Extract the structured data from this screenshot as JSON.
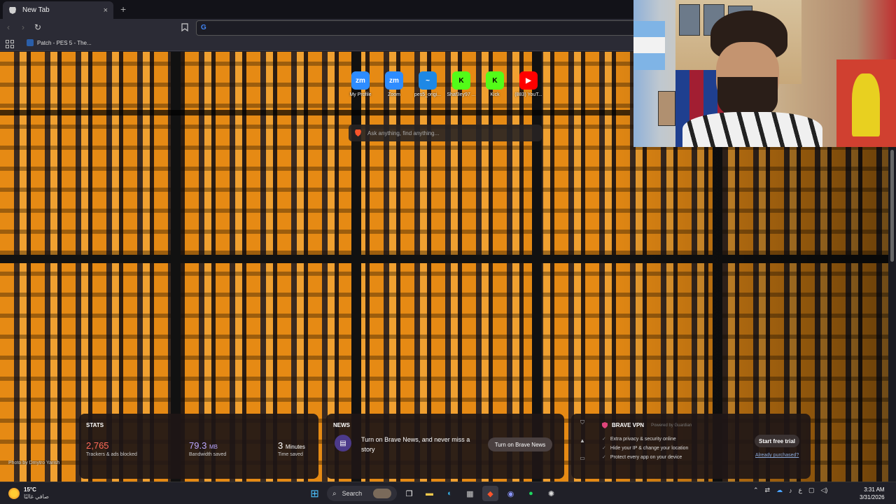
{
  "browser": {
    "tab_title": "New Tab",
    "tab_close": "×",
    "new_tab": "+",
    "back": "‹",
    "forward": "›",
    "reload": "↻",
    "url_value": "",
    "bookmark_label": "Patch - PES 5 - The..."
  },
  "top_sites": [
    {
      "label": "My Profile",
      "icon": "zm",
      "color": "#2d8cff"
    },
    {
      "label": "Zoom",
      "icon": "zm",
      "color": "#2d8cff"
    },
    {
      "label": "pes5_origi...",
      "icon": "~",
      "color": "#1e88e5"
    },
    {
      "label": "Shaf3ey97 ...",
      "icon": "K",
      "color": "#53fc18"
    },
    {
      "label": "Kick",
      "icon": "K",
      "color": "#53fc18"
    },
    {
      "label": "(883) YouT...",
      "icon": "▶",
      "color": "#ff0000"
    }
  ],
  "search": {
    "placeholder": "Ask anything, find anything..."
  },
  "photo_credit": "Photo by Dmytro Yarish",
  "stats": {
    "heading": "STATS",
    "trackers_value": "2,765",
    "trackers_label": "Trackers & ads blocked",
    "trackers_color": "#ff6a5a",
    "bandwidth_value": "79.3",
    "bandwidth_unit": "MB",
    "bandwidth_label": "Bandwidth saved",
    "bandwidth_color": "#b9a6ff",
    "time_value": "3",
    "time_unit": "Minutes",
    "time_label": "Time saved"
  },
  "news": {
    "heading": "NEWS",
    "text": "Turn on Brave News, and never miss a story",
    "button": "Turn on Brave News"
  },
  "vpn": {
    "title": "BRAVE VPN",
    "powered": "Powered by Guardian",
    "features": [
      "Extra privacy & security online",
      "Hide your IP & change your location",
      "Protect every app on your device"
    ],
    "button": "Start free trial",
    "link": "Already purchased?"
  },
  "taskbar": {
    "temp": "15°C",
    "weather": "صافي غالبًا",
    "search": "Search",
    "lang": "ع",
    "time": "3:31 AM",
    "date": "3/31/2026"
  }
}
